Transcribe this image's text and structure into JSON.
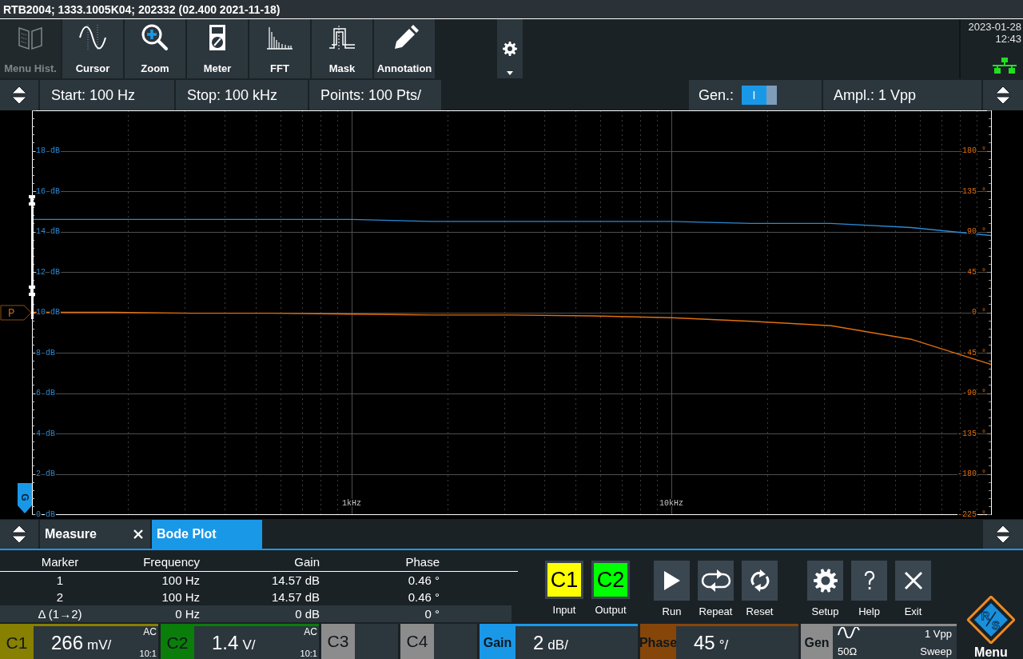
{
  "title_bar": {
    "title": "RTB2004; 1333.1005K04; 202332 (02.400 2021-11-18)"
  },
  "toolbar": {
    "items": [
      {
        "label": "Menu Hist.",
        "kind": "history",
        "disabled": true
      },
      {
        "label": "Cursor",
        "kind": "cursor",
        "disabled": false
      },
      {
        "label": "Zoom",
        "kind": "zoom",
        "disabled": false
      },
      {
        "label": "Meter",
        "kind": "meter",
        "disabled": false
      },
      {
        "label": "FFT",
        "kind": "fft",
        "disabled": false
      },
      {
        "label": "Mask",
        "kind": "mask",
        "disabled": false
      },
      {
        "label": "Annotation",
        "kind": "annotation",
        "disabled": false
      }
    ]
  },
  "clock": {
    "date": "2023-01-28",
    "time": "12:43"
  },
  "sweep_settings": {
    "fields": [
      "Start: 100 Hz",
      "Stop: 100 kHz",
      "Points: 100 Pts/"
    ],
    "generator": {
      "label": "Gen.:",
      "switch_text": "I",
      "on": true
    },
    "amplitude": "Ampl.: 1 Vpp"
  },
  "plot": {
    "tags": [
      {
        "kind": "phase",
        "text": "P"
      },
      {
        "kind": "gain",
        "text": "G"
      }
    ],
    "chart_data": {
      "type": "line",
      "grid": true,
      "categories": [
        null,
        null,
        null,
        null,
        "1kHz",
        null,
        null,
        null,
        "10kHz",
        null,
        null,
        null,
        null
      ],
      "ylim": [
        0,
        20
      ],
      "yticks": [
        {
          "value": 0,
          "label": "0 dB"
        },
        {
          "value": 2,
          "label": "2 dB"
        },
        {
          "value": 4,
          "label": "4 dB"
        },
        {
          "value": 6,
          "label": "6 dB"
        },
        {
          "value": 8,
          "label": "8 dB"
        },
        {
          "value": 10,
          "label": "10 dB"
        },
        {
          "value": 12,
          "label": "12 dB"
        },
        {
          "value": 14,
          "label": "14 dB"
        },
        {
          "value": 16,
          "label": "16 dB"
        },
        {
          "value": 18,
          "label": "18 dB"
        }
      ],
      "y2lim": [
        -225,
        225
      ],
      "y2ticks": [
        {
          "value": -225,
          "label": "-225 °"
        },
        {
          "value": -180,
          "label": "-180 °"
        },
        {
          "value": -135,
          "label": "-135 °"
        },
        {
          "value": -90,
          "label": "-90 °"
        },
        {
          "value": -45,
          "label": "-45 °"
        },
        {
          "value": 0,
          "label": "0 °"
        },
        {
          "value": 45,
          "label": "45 °"
        },
        {
          "value": 90,
          "label": "90 °"
        },
        {
          "value": 135,
          "label": "135 °"
        },
        {
          "value": 180,
          "label": "180 °"
        }
      ],
      "series": [
        {
          "color": "#2a8ad6",
          "values": [
            14.6,
            14.6,
            14.6,
            14.6,
            14.6,
            14.5,
            14.5,
            14.5,
            14.5,
            14.4,
            14.4,
            14.2,
            13.8
          ]
        },
        {
          "axis": "y2",
          "color": "#e0700f",
          "values": [
            0,
            0,
            -1,
            -1,
            -2,
            -3,
            -3,
            -4,
            -6,
            -10,
            -15,
            -30,
            -58
          ]
        }
      ]
    }
  },
  "panel_tabs": [
    {
      "label": "Measure",
      "selected": false,
      "closable": true
    },
    {
      "label": "Bode Plot",
      "selected": true,
      "closable": false
    }
  ],
  "results": {
    "columns": [
      "Marker",
      "Frequency",
      "Gain",
      "Phase"
    ],
    "rows": [
      {
        "kind": "marker",
        "cells": [
          "1",
          "100 Hz",
          "14.57 dB",
          "0.46 °"
        ]
      },
      {
        "kind": "marker",
        "cells": [
          "2",
          "100 Hz",
          "14.57 dB",
          "0.46 °"
        ]
      },
      {
        "kind": "delta",
        "cells": [
          "Δ (1→2)",
          "0 Hz",
          "0 dB",
          "0 °"
        ]
      }
    ]
  },
  "channel_buttons": [
    {
      "label": "C1",
      "caption": "Input",
      "color": "#ffff00"
    },
    {
      "label": "C2",
      "caption": "Output",
      "color": "#00ff00"
    }
  ],
  "action_groups": [
    [
      {
        "kind": "run",
        "caption": "Run"
      },
      {
        "kind": "repeat",
        "caption": "Repeat"
      },
      {
        "kind": "reset",
        "caption": "Reset"
      }
    ],
    [
      {
        "kind": "setup",
        "caption": "Setup"
      },
      {
        "kind": "help",
        "caption": "Help"
      },
      {
        "kind": "exit",
        "caption": "Exit"
      }
    ]
  ],
  "status_bar": {
    "segments": [
      {
        "kind": "channel",
        "name": "C1",
        "color": "#878000",
        "value": "266",
        "unit": "mV/",
        "coupling": "AC",
        "probe": "10:1"
      },
      {
        "kind": "channel",
        "name": "C2",
        "color": "#0b7d0b",
        "value": "1.4",
        "unit": "V/",
        "coupling": "AC",
        "probe": "10:1"
      },
      {
        "kind": "channel",
        "name": "C3",
        "color": "#8c8c8c"
      },
      {
        "kind": "channel",
        "name": "C4",
        "color": "#8c8c8c"
      },
      {
        "kind": "scale",
        "name": "Gain",
        "color": "#1a98e8",
        "value": "2",
        "unit": "dB/"
      },
      {
        "kind": "scale",
        "name": "Phase",
        "color": "#86460a",
        "value": "45",
        "unit": "°/"
      },
      {
        "kind": "generator",
        "name": "Gen",
        "color": "#8c8c8c",
        "impedance": "50Ω",
        "amplitude": "1 Vpp",
        "mode": "Sweep"
      }
    ],
    "menu": {
      "logo_letters": [
        "R",
        "S"
      ],
      "label": "Menu"
    }
  }
}
